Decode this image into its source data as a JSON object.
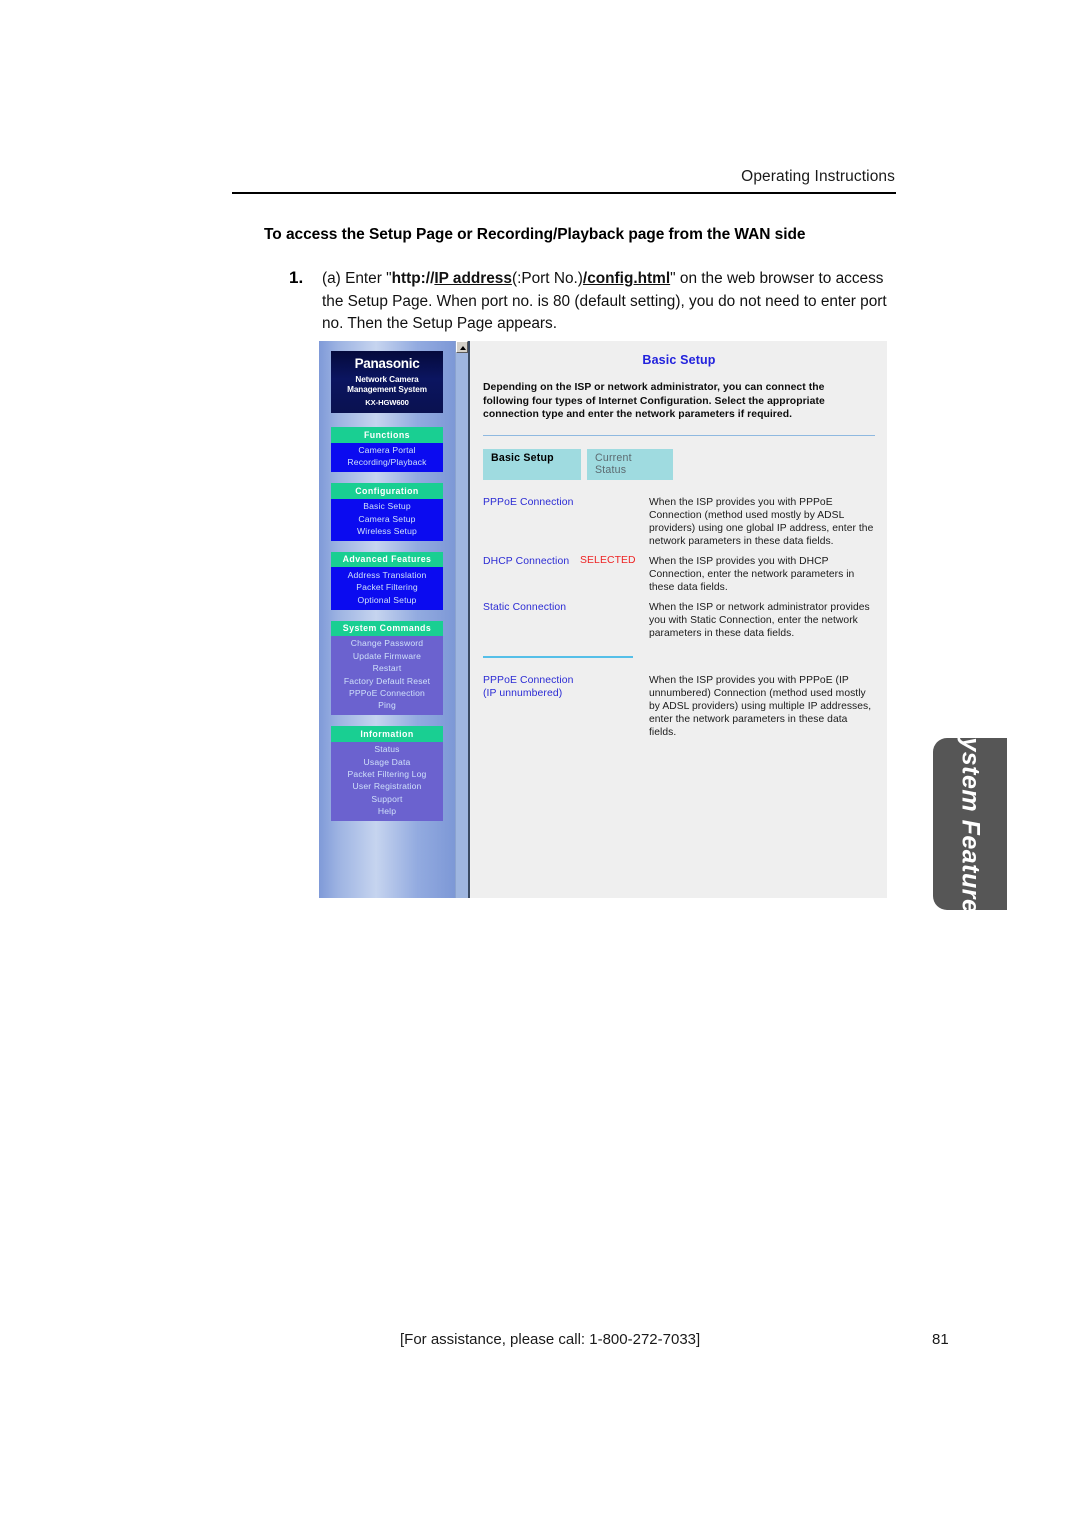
{
  "page": {
    "header_text": "Operating Instructions",
    "section_heading": "To access the Setup Page or Recording/Playback page from the WAN side",
    "footer_note": "[For assistance, please call: 1-800-272-7033]",
    "page_number": "81",
    "side_tab_label": "System Features"
  },
  "step": {
    "number": "1.",
    "prefix": "(a) Enter \"",
    "bold_http": "http://",
    "bold_underline_ip": "IP address",
    "mid": "(:Port No.)",
    "bold_underline_config": "/config.html",
    "after": "\" on the web browser to access the Setup Page. When port no. is 80 (default setting), you do not need to enter port no. Then the Setup Page appears."
  },
  "screenshot": {
    "logo": {
      "brand": "Panasonic",
      "subtitle_line1": "Network Camera",
      "subtitle_line2": "Management System",
      "model": "KX-HGW600"
    },
    "nav_groups": [
      {
        "heading": "Functions",
        "style": "blue",
        "items": [
          "Camera Portal",
          "Recording/Playback"
        ]
      },
      {
        "heading": "Configuration",
        "style": "blue",
        "items": [
          "Basic Setup",
          "Camera Setup",
          "Wireless Setup"
        ]
      },
      {
        "heading": "Advanced Features",
        "style": "blue",
        "items": [
          "Address Translation",
          "Packet Filtering",
          "Optional Setup"
        ]
      },
      {
        "heading": "System Commands",
        "style": "purple",
        "items": [
          "Change Password",
          "Update Firmware",
          "Restart",
          "Factory Default Reset",
          "PPPoE Connection",
          "Ping"
        ]
      },
      {
        "heading": "Information",
        "style": "purple",
        "items": [
          "Status",
          "Usage Data",
          "Packet Filtering Log",
          "User Registration",
          "Support",
          "Help"
        ]
      }
    ],
    "main": {
      "title": "Basic Setup",
      "intro": "Depending on the ISP or network administrator, you can connect the following four types of Internet Configuration. Select the appropriate connection type and enter the network parameters if required.",
      "tabs": [
        {
          "label": "Basic Setup",
          "active": true
        },
        {
          "label": "Current Status",
          "active": false
        }
      ],
      "connections": [
        {
          "name": "PPPoE Connection",
          "flag": "",
          "description": "When the ISP provides you with PPPoE Connection (method used mostly by ADSL providers) using one global IP address, enter the network parameters in these data fields."
        },
        {
          "name": "DHCP Connection",
          "flag": "SELECTED",
          "description": "When the ISP provides you with DHCP Connection, enter the network parameters in these data fields."
        },
        {
          "name": "Static Connection",
          "flag": "",
          "description": "When the ISP or network administrator provides you with Static Connection, enter the network parameters in these data fields."
        }
      ],
      "connections_secondary": [
        {
          "name": "PPPoE Connection (IP unnumbered)",
          "flag": "",
          "description": "When the ISP provides you with PPPoE (IP unnumbered) Connection (method used mostly by ADSL providers) using multiple IP addresses, enter the network parameters in these data fields."
        }
      ]
    }
  },
  "colors": {
    "nav_heading_green": "#19cf92",
    "nav_body_blue": "#0b0bf0",
    "nav_body_purple": "#6b62cf",
    "link_blue": "#2b2bd4",
    "selected_red": "#ee2222",
    "tab_cyan": "#9fdbe0",
    "side_tab_gray": "#565656"
  }
}
